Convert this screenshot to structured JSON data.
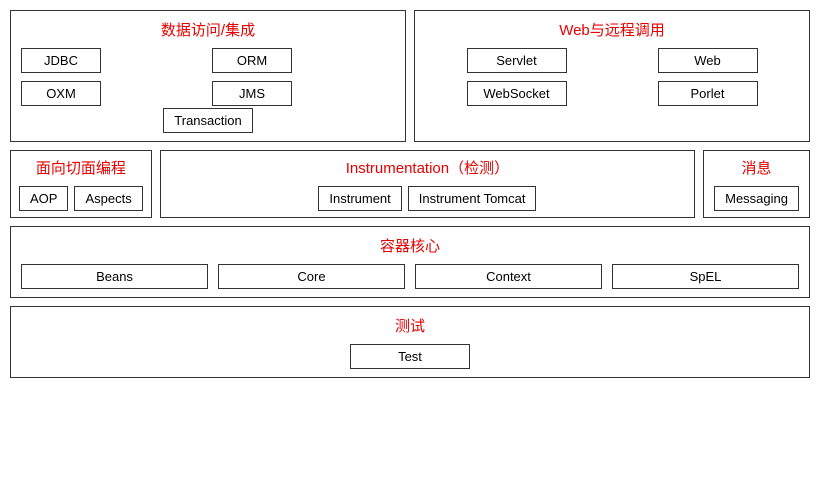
{
  "row1": {
    "dataAccess": {
      "title": "数据访问/集成",
      "modules": [
        "JDBC",
        "ORM",
        "OXM",
        "JMS"
      ],
      "transaction": "Transaction"
    },
    "web": {
      "title": "Web与远程调用",
      "modules": [
        "Servlet",
        "Web",
        "WebSocket",
        "Porlet"
      ]
    }
  },
  "row2": {
    "aop": {
      "title": "面向切面编程",
      "modules": [
        "AOP",
        "Aspects"
      ]
    },
    "instrumentation": {
      "title": "Instrumentation（检测）",
      "modules": [
        "Instrument",
        "Instrument Tomcat"
      ]
    },
    "messaging": {
      "title": "消息",
      "modules": [
        "Messaging"
      ]
    }
  },
  "row3": {
    "title": "容器核心",
    "modules": [
      "Beans",
      "Core",
      "Context",
      "SpEL"
    ]
  },
  "row4": {
    "title": "测试",
    "modules": [
      "Test"
    ]
  }
}
